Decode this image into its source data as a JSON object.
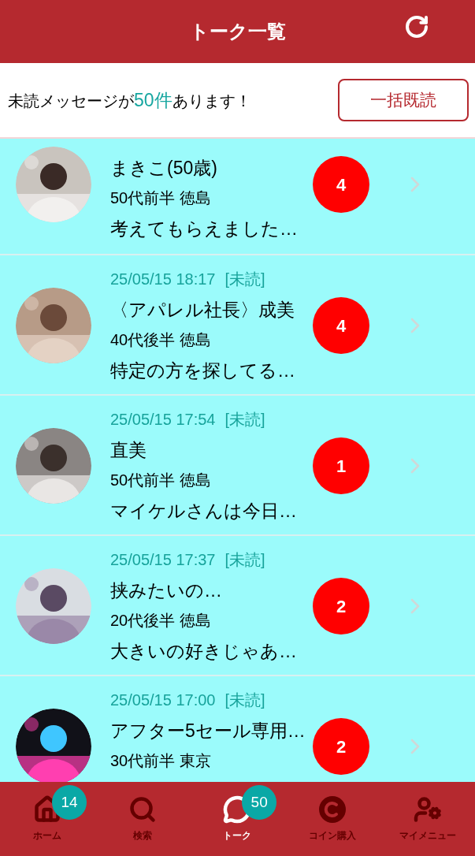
{
  "header": {
    "title": "トーク一覧"
  },
  "banner": {
    "text_before": "未読メッセージが",
    "count": "50件",
    "text_after": "あります！",
    "button": "一括既読"
  },
  "talks": [
    {
      "name": "まきこ(50歳)",
      "profile": "50代前半 徳島",
      "message": "考えてもらえました…",
      "unread": "4"
    },
    {
      "date": "25/05/15 18:17",
      "status": "[未読]",
      "name": "〈アパレル社長〉成美",
      "profile": "40代後半 徳島",
      "message": "特定の方を探してる…",
      "unread": "4"
    },
    {
      "date": "25/05/15 17:54",
      "status": "[未読]",
      "name": "直美",
      "profile": "50代前半 徳島",
      "message": "マイケルさんは今日…",
      "unread": "1"
    },
    {
      "date": "25/05/15 17:37",
      "status": "[未読]",
      "name": "挟みたいの…",
      "profile": "20代後半 徳島",
      "message": "大きいの好きじゃあ…",
      "unread": "2"
    },
    {
      "date": "25/05/15 17:00",
      "status": "[未読]",
      "name": "アフター5セール専用…",
      "profile": "30代前半 東京",
      "unread": "2"
    }
  ],
  "nav": [
    {
      "kind": "home",
      "label": "ホーム",
      "badge": "14",
      "selected": false
    },
    {
      "kind": "search",
      "label": "検索",
      "selected": false
    },
    {
      "kind": "talk",
      "label": "トーク",
      "badge": "50",
      "selected": true
    },
    {
      "kind": "coin",
      "label": "コイン購入",
      "selected": false
    },
    {
      "kind": "mymenu",
      "label": "マイメニュー",
      "selected": false
    }
  ]
}
